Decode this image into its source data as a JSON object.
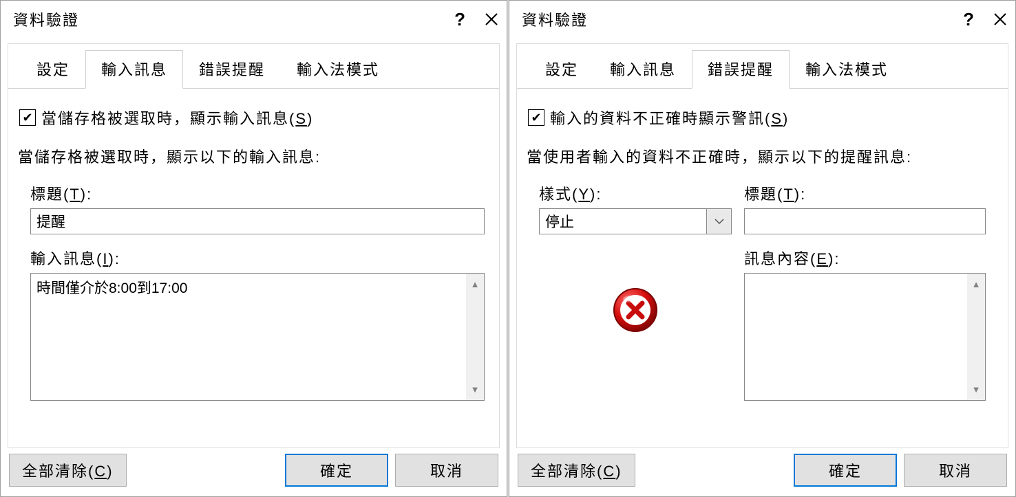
{
  "dialog1": {
    "title": "資料驗證",
    "tabs": [
      "設定",
      "輸入訊息",
      "錯誤提醒",
      "輸入法模式"
    ],
    "activeTabIndex": 1,
    "checkboxLabel_pre": "當儲存格被選取時，顯示輸入訊息(",
    "checkboxLabel_u": "S",
    "checkboxLabel_post": ")",
    "sectionText": "當儲存格被選取時，顯示以下的輸入訊息:",
    "titleLabel_pre": "標題(",
    "titleLabel_u": "T",
    "titleLabel_post": "):",
    "titleValue": "提醒",
    "msgLabel_pre": "輸入訊息(",
    "msgLabel_u": "I",
    "msgLabel_post": "):",
    "msgValue": "時間僅介於8:00到17:00"
  },
  "dialog2": {
    "title": "資料驗證",
    "tabs": [
      "設定",
      "輸入訊息",
      "錯誤提醒",
      "輸入法模式"
    ],
    "activeTabIndex": 2,
    "checkboxLabel_pre": "輸入的資料不正確時顯示警訊(",
    "checkboxLabel_u": "S",
    "checkboxLabel_post": ")",
    "sectionText": "當使用者輸入的資料不正確時，顯示以下的提醒訊息:",
    "styleLabel_pre": "樣式(",
    "styleLabel_u": "Y",
    "styleLabel_post": "):",
    "styleValue": "停止",
    "titleLabel_pre": "標題(",
    "titleLabel_u": "T",
    "titleLabel_post": "):",
    "titleValue": "",
    "errmsgLabel_pre": "訊息內容(",
    "errmsgLabel_u": "E",
    "errmsgLabel_post": "):",
    "errmsgValue": ""
  },
  "buttons": {
    "clearAll_pre": "全部清除(",
    "clearAll_u": "C",
    "clearAll_post": ")",
    "ok": "確定",
    "cancel": "取消"
  }
}
